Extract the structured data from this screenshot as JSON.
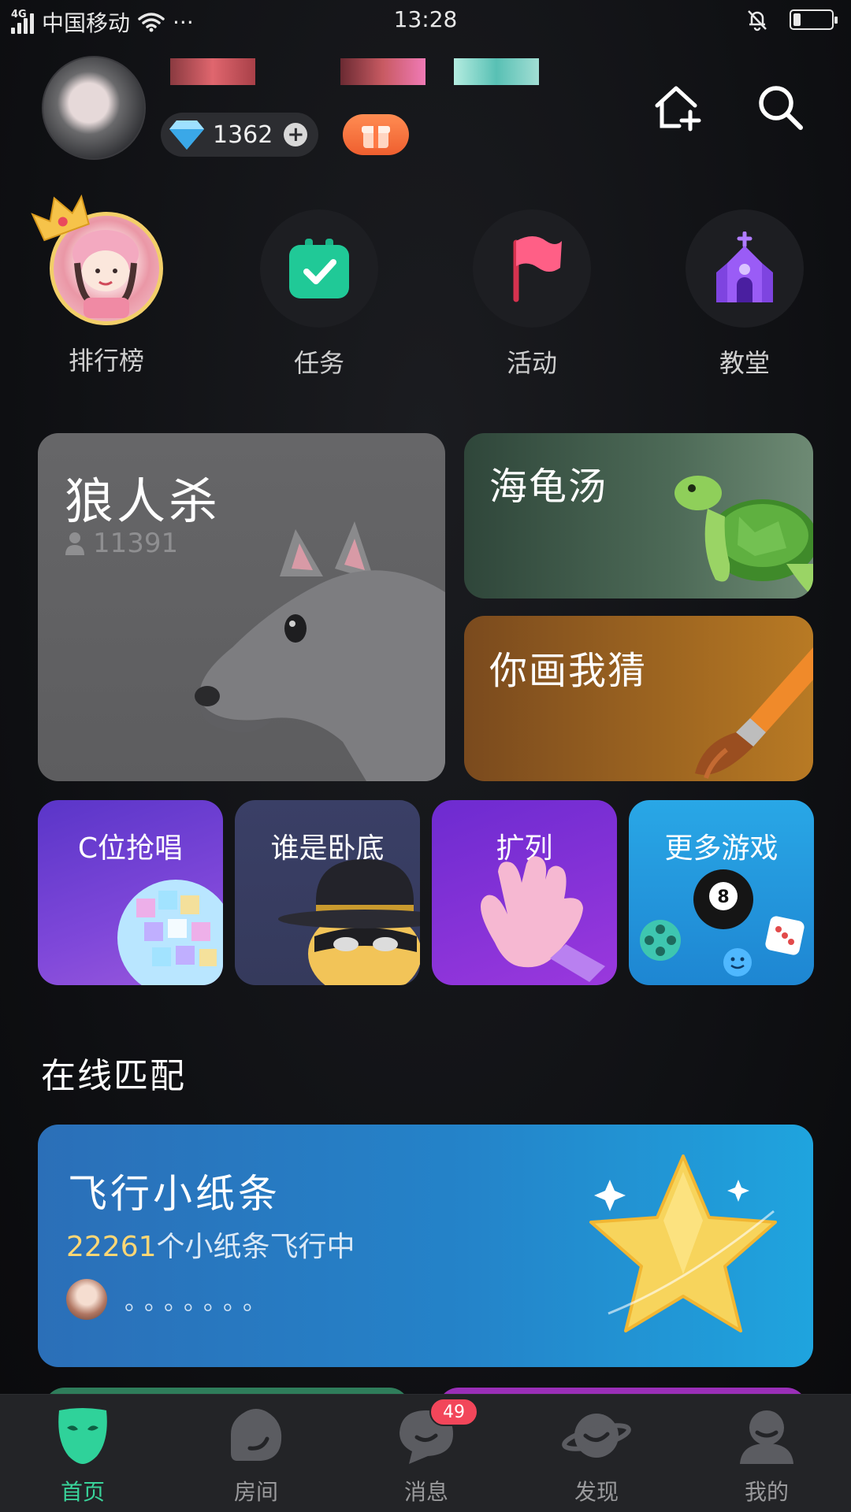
{
  "status_bar": {
    "network": "4G",
    "carrier": "中国移动",
    "more": "···",
    "time": "13:28",
    "battery_level": 0.2
  },
  "header": {
    "diamonds": "1362",
    "plus": "+",
    "icons": [
      "add-room-icon",
      "search-icon"
    ]
  },
  "quick_entries": [
    {
      "label": "排行榜",
      "icon": "crown-ranking-icon"
    },
    {
      "label": "任务",
      "icon": "task-calendar-icon"
    },
    {
      "label": "活动",
      "icon": "flag-icon"
    },
    {
      "label": "教堂",
      "icon": "church-icon"
    }
  ],
  "games": {
    "werewolf": {
      "title": "狼人杀",
      "count": "11391"
    },
    "turtle_soup": {
      "title": "海龟汤"
    },
    "draw_guess": {
      "title": "你画我猜"
    },
    "small": [
      {
        "title": "C位抢唱"
      },
      {
        "title": "谁是卧底"
      },
      {
        "title": "扩列"
      },
      {
        "title": "更多游戏"
      }
    ]
  },
  "online_match": {
    "section_title": "在线匹配",
    "paper_plane": {
      "title": "飞行小纸条",
      "count": "22261",
      "count_suffix": "个小纸条飞行中",
      "dots": "。。。。。。。"
    }
  },
  "bottom_nav": [
    {
      "label": "首页",
      "active": true
    },
    {
      "label": "房间",
      "active": false
    },
    {
      "label": "消息",
      "active": false,
      "badge": "49"
    },
    {
      "label": "发现",
      "active": false
    },
    {
      "label": "我的",
      "active": false
    }
  ],
  "colors": {
    "accent_green": "#39d39a",
    "badge_red": "#f2465a",
    "gold": "#ffd775"
  }
}
